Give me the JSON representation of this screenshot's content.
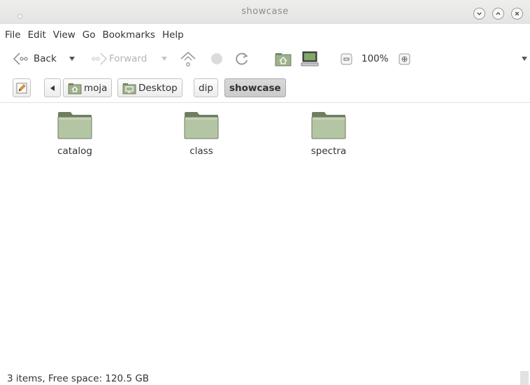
{
  "window": {
    "title": "showcase"
  },
  "menubar": {
    "items": [
      "File",
      "Edit",
      "View",
      "Go",
      "Bookmarks",
      "Help"
    ]
  },
  "toolbar": {
    "back_label": "Back",
    "forward_label": "Forward",
    "zoom_level": "100%",
    "icons": [
      "back-arrow-icon",
      "dropdown-icon",
      "forward-arrow-icon",
      "up-icon",
      "stop-icon",
      "reload-icon",
      "home-folder-icon",
      "computer-icon",
      "zoom-out-icon",
      "zoom-in-icon",
      "overflow-icon"
    ]
  },
  "location": {
    "crumbs": [
      {
        "label": "moja",
        "icon": "home-folder-icon"
      },
      {
        "label": "Desktop",
        "icon": "desktop-folder-icon"
      },
      {
        "label": "dip",
        "icon": ""
      },
      {
        "label": "showcase",
        "icon": "",
        "active": true
      }
    ]
  },
  "files": [
    {
      "name": "catalog",
      "type": "folder"
    },
    {
      "name": "class",
      "type": "folder"
    },
    {
      "name": "spectra",
      "type": "folder"
    }
  ],
  "status": {
    "text": "3 items, Free space: 120.5 GB"
  },
  "colors": {
    "folder_fill": "#b4c5a3",
    "folder_tab": "#6f7d61",
    "active_crumb": "#cfcfcf"
  }
}
